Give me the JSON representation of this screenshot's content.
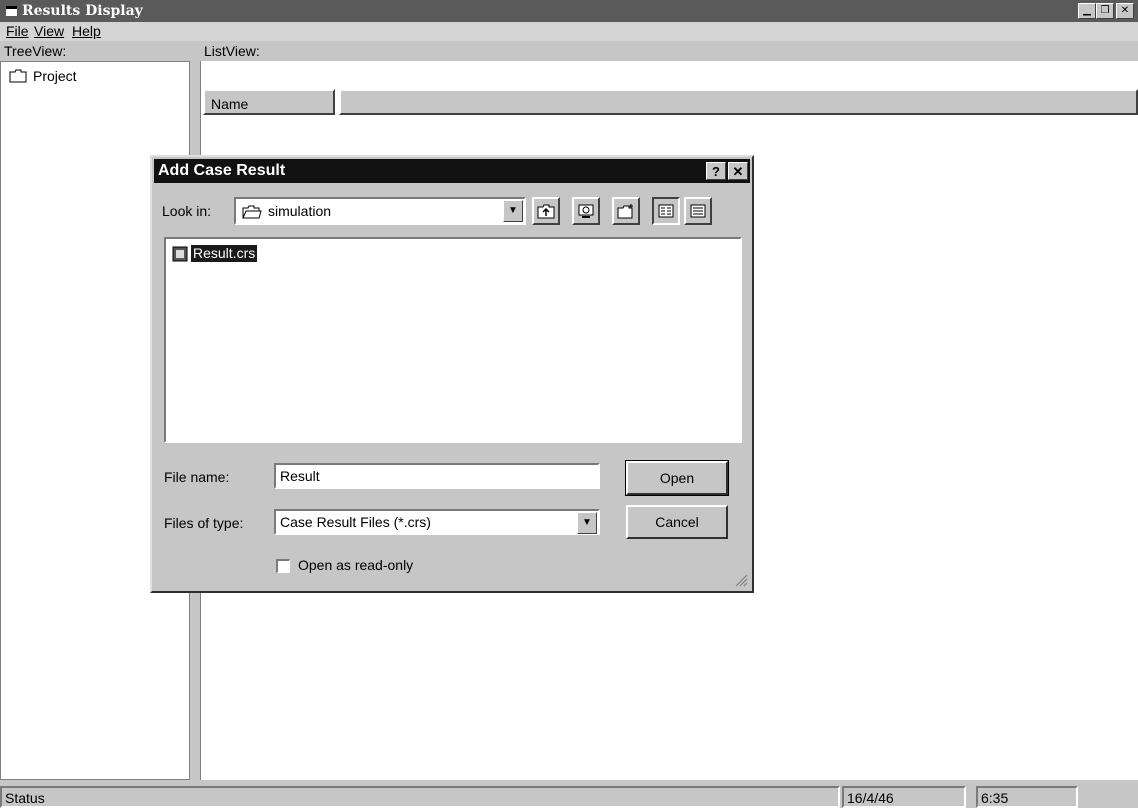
{
  "window": {
    "title": "Results Display",
    "controls": [
      "minimize",
      "maximize",
      "close"
    ]
  },
  "menu": {
    "items": [
      "File",
      "View",
      "Help"
    ]
  },
  "tree": {
    "header": "TreeView:",
    "items": [
      {
        "label": "Project",
        "icon": "folder-icon"
      }
    ]
  },
  "list": {
    "header": "ListView:",
    "columns": [
      "Name"
    ]
  },
  "status": {
    "label": "Status",
    "date": "16/4/46",
    "time": "6:35"
  },
  "dialog": {
    "title": "Add Case Result",
    "help_btn": "?",
    "close_btn": "✕",
    "look_in_label": "Look in:",
    "look_in_value": "simulation",
    "toolbar": [
      "up-one-level-icon",
      "go-to-desktop-icon",
      "create-new-folder-icon",
      "list-view-icon",
      "details-view-icon"
    ],
    "files": [
      {
        "name": "Result.crs",
        "selected": true
      }
    ],
    "file_name_label": "File name:",
    "file_name_value": "Result",
    "file_type_label": "Files of type:",
    "file_type_value": "Case Result Files (*.crs)",
    "open_btn": "Open",
    "cancel_btn": "Cancel",
    "readonly_label": "Open as read-only",
    "readonly_checked": false
  }
}
